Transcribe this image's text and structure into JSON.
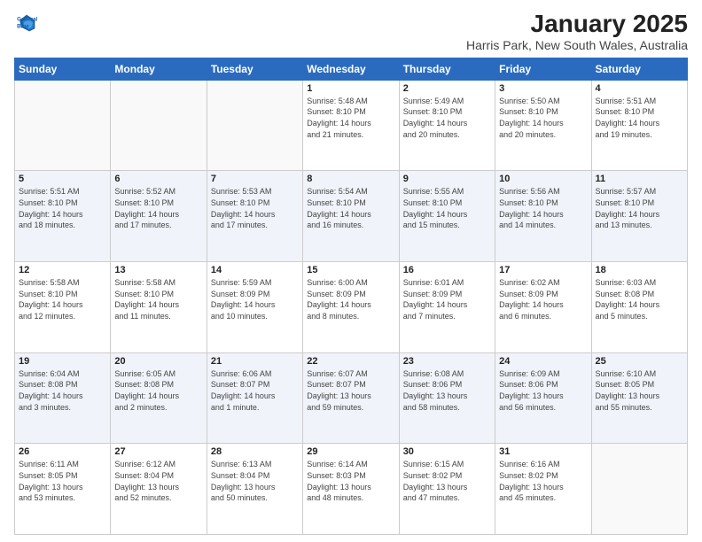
{
  "logo": {
    "line1": "General",
    "line2": "Blue"
  },
  "title": "January 2025",
  "subtitle": "Harris Park, New South Wales, Australia",
  "days_of_week": [
    "Sunday",
    "Monday",
    "Tuesday",
    "Wednesday",
    "Thursday",
    "Friday",
    "Saturday"
  ],
  "weeks": [
    [
      {
        "num": "",
        "info": ""
      },
      {
        "num": "",
        "info": ""
      },
      {
        "num": "",
        "info": ""
      },
      {
        "num": "1",
        "info": "Sunrise: 5:48 AM\nSunset: 8:10 PM\nDaylight: 14 hours\nand 21 minutes."
      },
      {
        "num": "2",
        "info": "Sunrise: 5:49 AM\nSunset: 8:10 PM\nDaylight: 14 hours\nand 20 minutes."
      },
      {
        "num": "3",
        "info": "Sunrise: 5:50 AM\nSunset: 8:10 PM\nDaylight: 14 hours\nand 20 minutes."
      },
      {
        "num": "4",
        "info": "Sunrise: 5:51 AM\nSunset: 8:10 PM\nDaylight: 14 hours\nand 19 minutes."
      }
    ],
    [
      {
        "num": "5",
        "info": "Sunrise: 5:51 AM\nSunset: 8:10 PM\nDaylight: 14 hours\nand 18 minutes."
      },
      {
        "num": "6",
        "info": "Sunrise: 5:52 AM\nSunset: 8:10 PM\nDaylight: 14 hours\nand 17 minutes."
      },
      {
        "num": "7",
        "info": "Sunrise: 5:53 AM\nSunset: 8:10 PM\nDaylight: 14 hours\nand 17 minutes."
      },
      {
        "num": "8",
        "info": "Sunrise: 5:54 AM\nSunset: 8:10 PM\nDaylight: 14 hours\nand 16 minutes."
      },
      {
        "num": "9",
        "info": "Sunrise: 5:55 AM\nSunset: 8:10 PM\nDaylight: 14 hours\nand 15 minutes."
      },
      {
        "num": "10",
        "info": "Sunrise: 5:56 AM\nSunset: 8:10 PM\nDaylight: 14 hours\nand 14 minutes."
      },
      {
        "num": "11",
        "info": "Sunrise: 5:57 AM\nSunset: 8:10 PM\nDaylight: 14 hours\nand 13 minutes."
      }
    ],
    [
      {
        "num": "12",
        "info": "Sunrise: 5:58 AM\nSunset: 8:10 PM\nDaylight: 14 hours\nand 12 minutes."
      },
      {
        "num": "13",
        "info": "Sunrise: 5:58 AM\nSunset: 8:10 PM\nDaylight: 14 hours\nand 11 minutes."
      },
      {
        "num": "14",
        "info": "Sunrise: 5:59 AM\nSunset: 8:09 PM\nDaylight: 14 hours\nand 10 minutes."
      },
      {
        "num": "15",
        "info": "Sunrise: 6:00 AM\nSunset: 8:09 PM\nDaylight: 14 hours\nand 8 minutes."
      },
      {
        "num": "16",
        "info": "Sunrise: 6:01 AM\nSunset: 8:09 PM\nDaylight: 14 hours\nand 7 minutes."
      },
      {
        "num": "17",
        "info": "Sunrise: 6:02 AM\nSunset: 8:09 PM\nDaylight: 14 hours\nand 6 minutes."
      },
      {
        "num": "18",
        "info": "Sunrise: 6:03 AM\nSunset: 8:08 PM\nDaylight: 14 hours\nand 5 minutes."
      }
    ],
    [
      {
        "num": "19",
        "info": "Sunrise: 6:04 AM\nSunset: 8:08 PM\nDaylight: 14 hours\nand 3 minutes."
      },
      {
        "num": "20",
        "info": "Sunrise: 6:05 AM\nSunset: 8:08 PM\nDaylight: 14 hours\nand 2 minutes."
      },
      {
        "num": "21",
        "info": "Sunrise: 6:06 AM\nSunset: 8:07 PM\nDaylight: 14 hours\nand 1 minute."
      },
      {
        "num": "22",
        "info": "Sunrise: 6:07 AM\nSunset: 8:07 PM\nDaylight: 13 hours\nand 59 minutes."
      },
      {
        "num": "23",
        "info": "Sunrise: 6:08 AM\nSunset: 8:06 PM\nDaylight: 13 hours\nand 58 minutes."
      },
      {
        "num": "24",
        "info": "Sunrise: 6:09 AM\nSunset: 8:06 PM\nDaylight: 13 hours\nand 56 minutes."
      },
      {
        "num": "25",
        "info": "Sunrise: 6:10 AM\nSunset: 8:05 PM\nDaylight: 13 hours\nand 55 minutes."
      }
    ],
    [
      {
        "num": "26",
        "info": "Sunrise: 6:11 AM\nSunset: 8:05 PM\nDaylight: 13 hours\nand 53 minutes."
      },
      {
        "num": "27",
        "info": "Sunrise: 6:12 AM\nSunset: 8:04 PM\nDaylight: 13 hours\nand 52 minutes."
      },
      {
        "num": "28",
        "info": "Sunrise: 6:13 AM\nSunset: 8:04 PM\nDaylight: 13 hours\nand 50 minutes."
      },
      {
        "num": "29",
        "info": "Sunrise: 6:14 AM\nSunset: 8:03 PM\nDaylight: 13 hours\nand 48 minutes."
      },
      {
        "num": "30",
        "info": "Sunrise: 6:15 AM\nSunset: 8:02 PM\nDaylight: 13 hours\nand 47 minutes."
      },
      {
        "num": "31",
        "info": "Sunrise: 6:16 AM\nSunset: 8:02 PM\nDaylight: 13 hours\nand 45 minutes."
      },
      {
        "num": "",
        "info": ""
      }
    ]
  ]
}
